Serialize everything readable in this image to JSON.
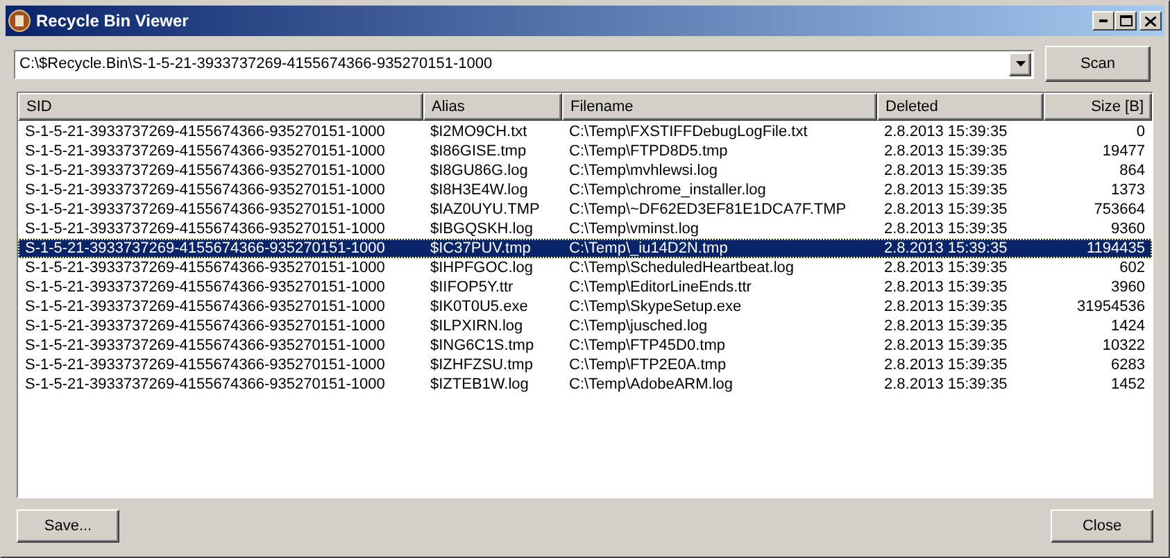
{
  "window": {
    "title": "Recycle Bin Viewer"
  },
  "path_field": {
    "value": "C:\\$Recycle.Bin\\S-1-5-21-3933737269-4155674366-935270151-1000"
  },
  "scan_button": "Scan",
  "table": {
    "columns": [
      "SID",
      "Alias",
      "Filename",
      "Deleted",
      "Size [B]"
    ],
    "rows": [
      {
        "cells": [
          "S-1-5-21-3933737269-4155674366-935270151-1000",
          "$I2MO9CH.txt",
          "C:\\Temp\\FXSTIFFDebugLogFile.txt",
          "2.8.2013 15:39:35",
          "0"
        ],
        "selected": false
      },
      {
        "cells": [
          "S-1-5-21-3933737269-4155674366-935270151-1000",
          "$I86GISE.tmp",
          "C:\\Temp\\FTPD8D5.tmp",
          "2.8.2013 15:39:35",
          "19477"
        ],
        "selected": false
      },
      {
        "cells": [
          "S-1-5-21-3933737269-4155674366-935270151-1000",
          "$I8GU86G.log",
          "C:\\Temp\\mvhlewsi.log",
          "2.8.2013 15:39:35",
          "864"
        ],
        "selected": false
      },
      {
        "cells": [
          "S-1-5-21-3933737269-4155674366-935270151-1000",
          "$I8H3E4W.log",
          "C:\\Temp\\chrome_installer.log",
          "2.8.2013 15:39:35",
          "1373"
        ],
        "selected": false
      },
      {
        "cells": [
          "S-1-5-21-3933737269-4155674366-935270151-1000",
          "$IAZ0UYU.TMP",
          "C:\\Temp\\~DF62ED3EF81E1DCA7F.TMP",
          "2.8.2013 15:39:35",
          "753664"
        ],
        "selected": false
      },
      {
        "cells": [
          "S-1-5-21-3933737269-4155674366-935270151-1000",
          "$IBGQSKH.log",
          "C:\\Temp\\vminst.log",
          "2.8.2013 15:39:35",
          "9360"
        ],
        "selected": false
      },
      {
        "cells": [
          "S-1-5-21-3933737269-4155674366-935270151-1000",
          "$IC37PUV.tmp",
          "C:\\Temp\\_iu14D2N.tmp",
          "2.8.2013 15:39:35",
          "1194435"
        ],
        "selected": true
      },
      {
        "cells": [
          "S-1-5-21-3933737269-4155674366-935270151-1000",
          "$IHPFGOC.log",
          "C:\\Temp\\ScheduledHeartbeat.log",
          "2.8.2013 15:39:35",
          "602"
        ],
        "selected": false
      },
      {
        "cells": [
          "S-1-5-21-3933737269-4155674366-935270151-1000",
          "$IIFOP5Y.ttr",
          "C:\\Temp\\EditorLineEnds.ttr",
          "2.8.2013 15:39:35",
          "3960"
        ],
        "selected": false
      },
      {
        "cells": [
          "S-1-5-21-3933737269-4155674366-935270151-1000",
          "$IK0T0U5.exe",
          "C:\\Temp\\SkypeSetup.exe",
          "2.8.2013 15:39:35",
          "31954536"
        ],
        "selected": false
      },
      {
        "cells": [
          "S-1-5-21-3933737269-4155674366-935270151-1000",
          "$ILPXIRN.log",
          "C:\\Temp\\jusched.log",
          "2.8.2013 15:39:35",
          "1424"
        ],
        "selected": false
      },
      {
        "cells": [
          "S-1-5-21-3933737269-4155674366-935270151-1000",
          "$ING6C1S.tmp",
          "C:\\Temp\\FTP45D0.tmp",
          "2.8.2013 15:39:35",
          "10322"
        ],
        "selected": false
      },
      {
        "cells": [
          "S-1-5-21-3933737269-4155674366-935270151-1000",
          "$IZHFZSU.tmp",
          "C:\\Temp\\FTP2E0A.tmp",
          "2.8.2013 15:39:35",
          "6283"
        ],
        "selected": false
      },
      {
        "cells": [
          "S-1-5-21-3933737269-4155674366-935270151-1000",
          "$IZTEB1W.log",
          "C:\\Temp\\AdobeARM.log",
          "2.8.2013 15:39:35",
          "1452"
        ],
        "selected": false
      }
    ]
  },
  "buttons": [
    "Save...",
    "Close"
  ]
}
